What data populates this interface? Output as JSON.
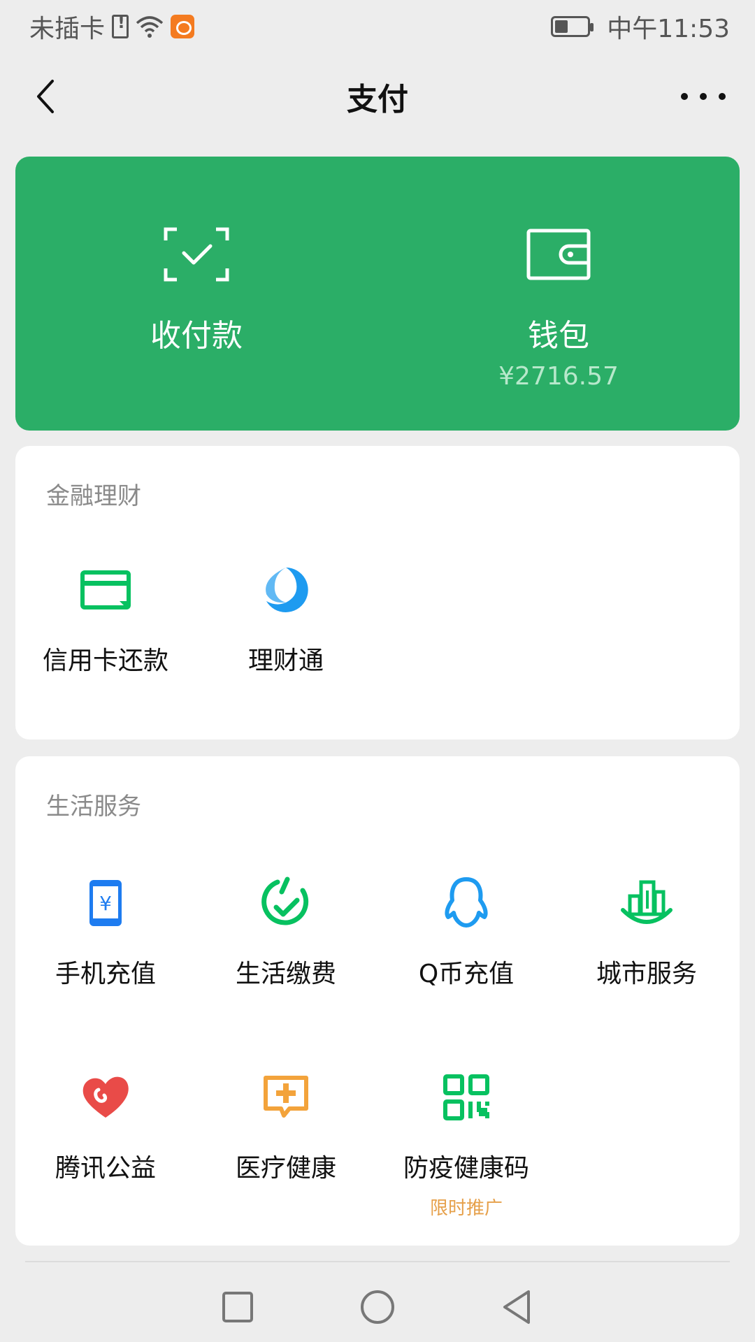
{
  "status_bar": {
    "carrier": "未插卡",
    "time": "中午11:53"
  },
  "nav": {
    "title": "支付"
  },
  "pay_card": {
    "receive_pay_label": "收付款",
    "wallet_label": "钱包",
    "wallet_balance": "¥2716.57",
    "bg_color": "#2BAE67"
  },
  "finance": {
    "title": "金融理财",
    "items": [
      {
        "label": "信用卡还款",
        "icon": "credit-card-icon",
        "color": "#07C160"
      },
      {
        "label": "理财通",
        "icon": "licaitong-icon",
        "color": "#1E9BF0"
      }
    ]
  },
  "life": {
    "title": "生活服务",
    "items": [
      {
        "label": "手机充值",
        "icon": "phone-recharge-icon",
        "color": "#1E7CF0"
      },
      {
        "label": "生活缴费",
        "icon": "bill-pay-icon",
        "color": "#07C160"
      },
      {
        "label": "Q币充值",
        "icon": "qq-icon",
        "color": "#1E9BF0"
      },
      {
        "label": "城市服务",
        "icon": "city-service-icon",
        "color": "#07C160"
      },
      {
        "label": "腾讯公益",
        "icon": "charity-heart-icon",
        "color": "#E94B48"
      },
      {
        "label": "医疗健康",
        "icon": "medical-icon",
        "color": "#F3A33B"
      },
      {
        "label": "防疫健康码",
        "icon": "qr-code-icon",
        "color": "#07C160",
        "badge": "限时推广"
      }
    ]
  }
}
